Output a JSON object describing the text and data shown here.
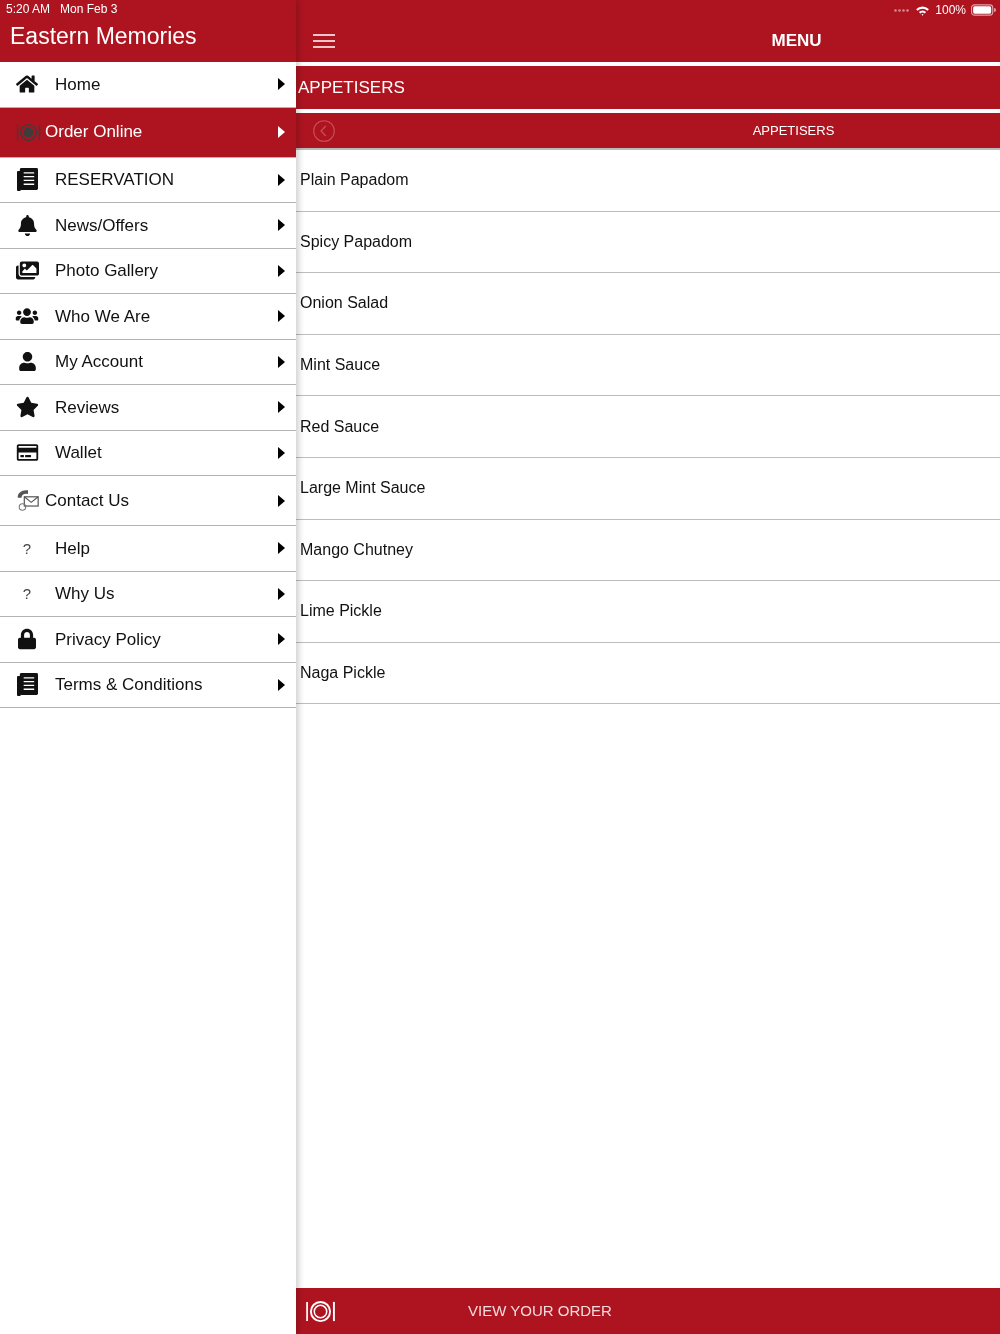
{
  "status_bar": {
    "time": "5:20 AM",
    "date": "Mon Feb 3",
    "battery": "100%"
  },
  "sidebar": {
    "title": "Eastern Memories",
    "items": [
      {
        "label": "Home",
        "kind": "home",
        "selected": false
      },
      {
        "label": "Order Online",
        "kind": "plate",
        "selected": true
      },
      {
        "label": "RESERVATION",
        "kind": "document",
        "selected": false
      },
      {
        "label": "News/Offers",
        "kind": "bell",
        "selected": false
      },
      {
        "label": "Photo Gallery",
        "kind": "photos",
        "selected": false
      },
      {
        "label": "Who We Are",
        "kind": "group",
        "selected": false
      },
      {
        "label": "My Account",
        "kind": "user",
        "selected": false
      },
      {
        "label": "Reviews",
        "kind": "star",
        "selected": false
      },
      {
        "label": "Wallet",
        "kind": "card",
        "selected": false
      },
      {
        "label": "Contact Us",
        "kind": "contact",
        "selected": false
      },
      {
        "label": "Help",
        "kind": "glyph",
        "icon_text": "?",
        "selected": false
      },
      {
        "label": "Why Us",
        "kind": "glyph",
        "icon_text": "?",
        "selected": false
      },
      {
        "label": "Privacy Policy",
        "kind": "lock",
        "selected": false
      },
      {
        "label": "Terms & Conditions",
        "kind": "document",
        "selected": false
      }
    ]
  },
  "header": {
    "title": "MENU"
  },
  "category_bar": {
    "title": "APPETISERS"
  },
  "subcategory_bar": {
    "title": "APPETISERS"
  },
  "menu_items": [
    "Plain Papadom",
    "Spicy Papadom",
    "Onion Salad",
    "Mint Sauce",
    "Red Sauce",
    "Large Mint Sauce",
    "Mango Chutney",
    "Lime Pickle",
    "Naga Pickle"
  ],
  "order_bar": {
    "label": "VIEW YOUR ORDER"
  }
}
